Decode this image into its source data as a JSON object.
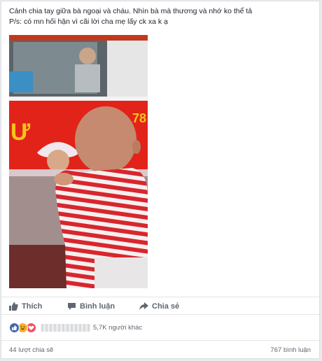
{
  "post": {
    "caption_line1": "Cảnh chia tay giữa bà ngoại và cháu. Nhìn bà mà thương và nhớ ko thể tả",
    "caption_line2": "P/s: có mn hối hận vì cãi lời cha mẹ lấy ck xa k ạ",
    "bus_number_fragment": "78"
  },
  "actions": {
    "like": "Thích",
    "comment": "Bình luận",
    "share": "Chia sẻ"
  },
  "reactions": {
    "others": "5,7K người khác",
    "types": [
      "like-icon",
      "haha-icon",
      "love-icon"
    ],
    "colors": {
      "like": "#4267b2",
      "haha": "#f7b125",
      "love": "#f25268"
    }
  },
  "footer": {
    "shares": "44 lượt chia sẽ",
    "comments": "767 bình luận"
  }
}
